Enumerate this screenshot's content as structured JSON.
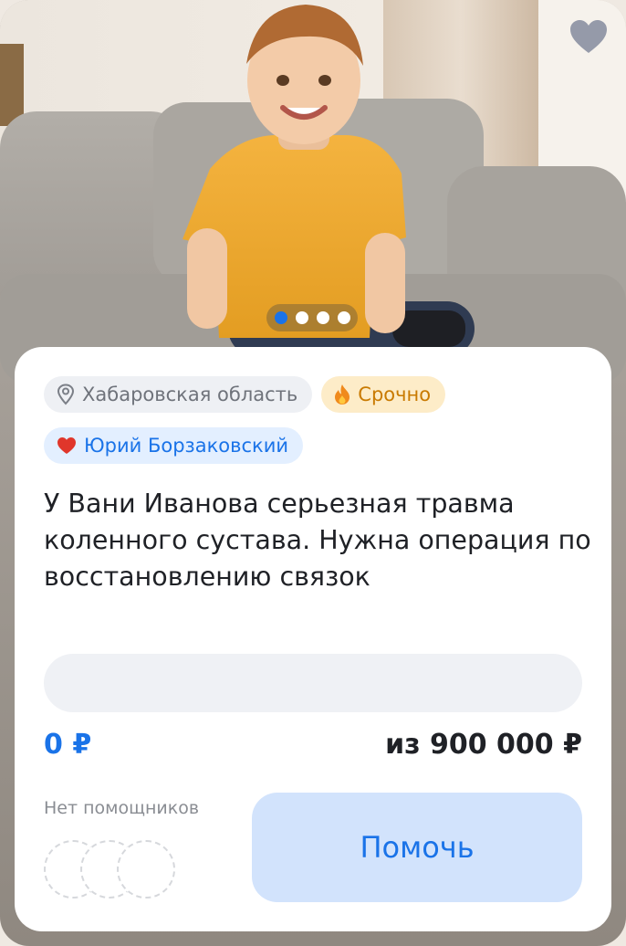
{
  "photo": {
    "description_icon": "child-on-sofa-photo",
    "favorite_icon": "heart-icon",
    "slides": [
      {
        "active": true
      },
      {
        "active": false
      },
      {
        "active": false
      },
      {
        "active": false
      }
    ]
  },
  "tags": {
    "region": {
      "icon": "location-pin-icon",
      "label": "Хабаровская область"
    },
    "urgent": {
      "icon": "fire-icon",
      "label": "Срочно"
    },
    "author": {
      "icon": "red-heart-icon",
      "label": "Юрий Борзаковский"
    }
  },
  "fundraiser": {
    "title": "У Вани Иванова серьезная травма коленного сустава. Нужна операция по восстановлению связок",
    "raised": "0 ₽",
    "goal": "из 900 000 ₽",
    "progress_fraction": 0,
    "helpers_label": "Нет помощников",
    "help_button": "Помочь"
  },
  "colors": {
    "accent": "#1a73e8",
    "button_bg": "#d2e3fc",
    "urgent_bg": "#fdecc8",
    "urgent_text": "#c97a00"
  }
}
